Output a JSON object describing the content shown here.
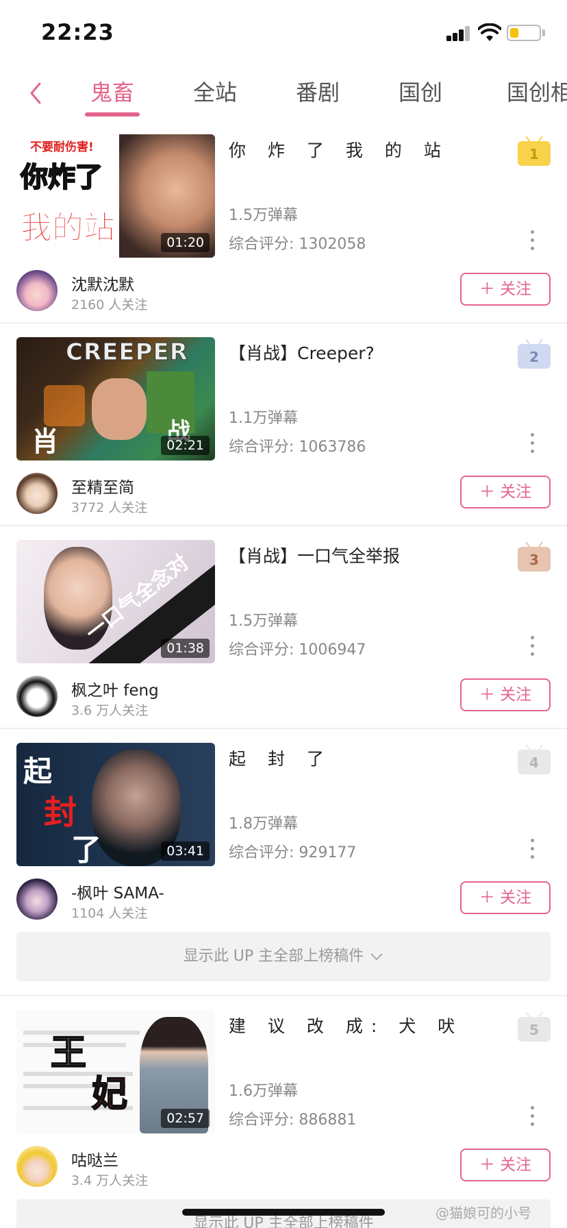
{
  "status_bar": {
    "time": "22:23"
  },
  "tabs": [
    {
      "label": "鬼畜",
      "active": true
    },
    {
      "label": "全站"
    },
    {
      "label": "番剧"
    },
    {
      "label": "国创"
    },
    {
      "label": "国创相"
    }
  ],
  "items": [
    {
      "rank": "1",
      "title": "你 炸 了 我 的 站",
      "danmaku": "1.5万弹幕",
      "score": "综合评分: 1302058",
      "duration": "01:20",
      "thumb_text": [
        "不要耐伤害!",
        "你炸了",
        "我的站"
      ],
      "up_name": "沈默沈默",
      "followers": "2160 人关注",
      "follow_label": "＋ 关注"
    },
    {
      "rank": "2",
      "title": "【肖战】Creeper?",
      "danmaku": "1.1万弹幕",
      "score": "综合评分: 1063786",
      "duration": "02:21",
      "thumb_text": [
        "CREEPER",
        "肖",
        "战"
      ],
      "up_name": "至精至简",
      "followers": "3772 人关注",
      "follow_label": "＋ 关注"
    },
    {
      "rank": "3",
      "title": "【肖战】一口气全举报",
      "danmaku": "1.5万弹幕",
      "score": "综合评分: 1006947",
      "duration": "01:38",
      "thumb_text": [
        "一口气全念对"
      ],
      "up_name": "枫之叶 feng",
      "followers": "3.6 万人关注",
      "follow_label": "＋ 关注"
    },
    {
      "rank": "4",
      "title": "起 封 了",
      "danmaku": "1.8万弹幕",
      "score": "综合评分: 929177",
      "duration": "03:41",
      "thumb_text": [
        "起",
        "封",
        "了"
      ],
      "up_name": "-枫叶 SAMA-",
      "followers": "1104 人关注",
      "follow_label": "＋ 关注"
    },
    {
      "rank": "5",
      "title": "建 议 改 成: 犬 吠",
      "danmaku": "1.6万弹幕",
      "score": "综合评分: 886881",
      "duration": "02:57",
      "thumb_text": [
        "王",
        "妃"
      ],
      "up_name": "咕哒兰",
      "followers": "3.4 万人关注",
      "follow_label": "＋ 关注"
    }
  ],
  "show_all_label": "显示此 UP 主全部上榜稿件",
  "watermark": "@猫娘可的小号",
  "colors": {
    "accent": "#e4648a",
    "rank1": "#f8d24a",
    "rank2": "#cfdaf0",
    "rank3": "#e6c4b0",
    "rank_other": "#e8e8e8"
  }
}
